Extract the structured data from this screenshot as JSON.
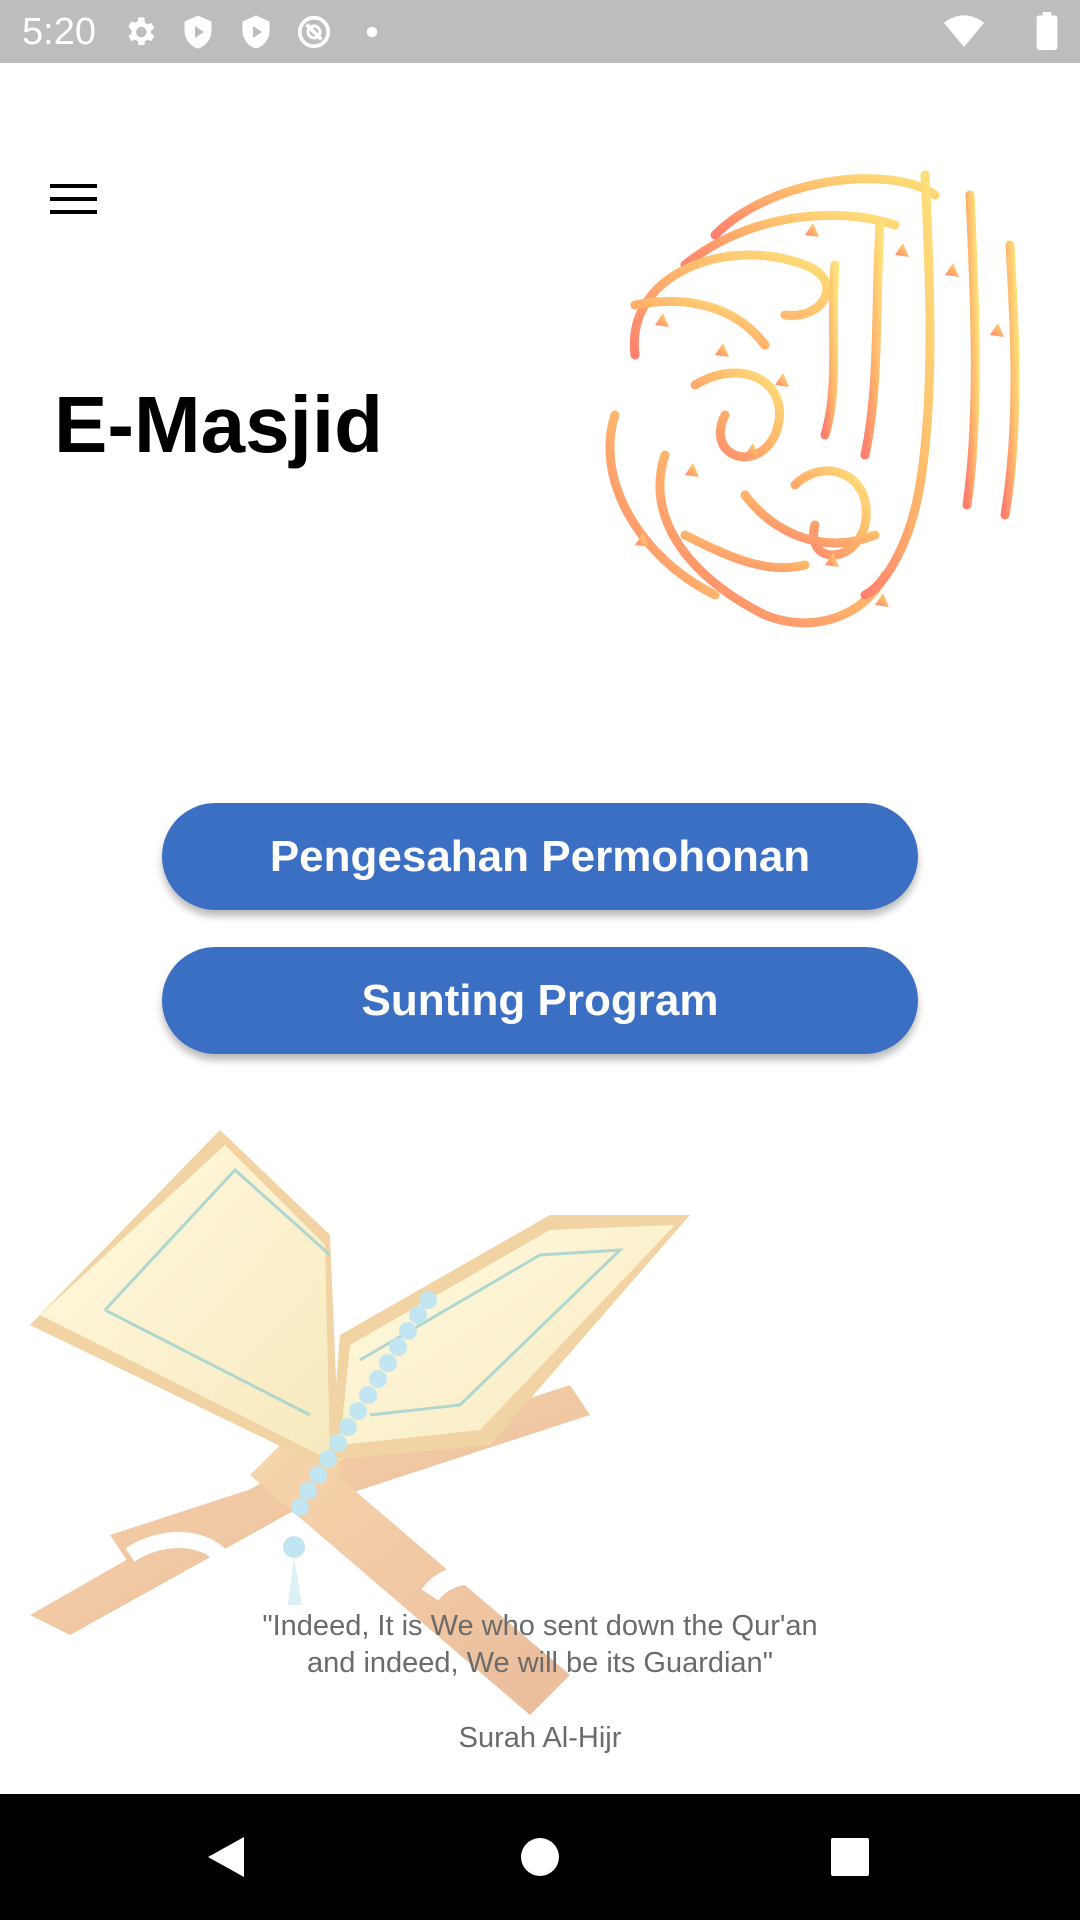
{
  "status_bar": {
    "time": "5:20",
    "icons": [
      "settings-icon",
      "shield-icon",
      "shield-icon",
      "do-not-disturb-icon",
      "notification-dot-icon",
      "wifi-icon",
      "battery-icon"
    ]
  },
  "header": {
    "menu_icon": "menu-icon",
    "title": "E-Masjid",
    "logo": "quran-calligraphy-logo"
  },
  "actions": {
    "approve_label": "Pengesahan Permohonan",
    "edit_label": "Sunting Program"
  },
  "quote": {
    "line1": "\"Indeed, It is We who sent down the Qur'an",
    "line2": "and indeed, We will be its Guardian\"",
    "source": "Surah Al-Hijr"
  },
  "nav_bar": {
    "icons": [
      "back-icon",
      "home-icon",
      "recents-icon"
    ]
  },
  "colors": {
    "button": "#3b6fc4",
    "status_bar": "#bdbdbd",
    "nav_bar": "#000000",
    "quote_text": "#6b6b6b"
  }
}
